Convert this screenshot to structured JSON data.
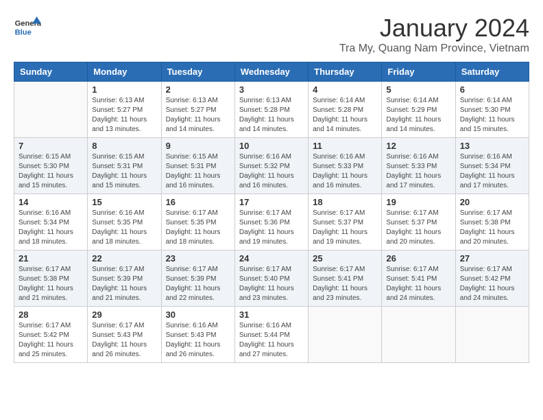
{
  "header": {
    "logo_general": "General",
    "logo_blue": "Blue",
    "month_title": "January 2024",
    "location": "Tra My, Quang Nam Province, Vietnam"
  },
  "calendar": {
    "headers": [
      "Sunday",
      "Monday",
      "Tuesday",
      "Wednesday",
      "Thursday",
      "Friday",
      "Saturday"
    ],
    "weeks": [
      [
        {
          "day": "",
          "info": ""
        },
        {
          "day": "1",
          "info": "Sunrise: 6:13 AM\nSunset: 5:27 PM\nDaylight: 11 hours\nand 13 minutes."
        },
        {
          "day": "2",
          "info": "Sunrise: 6:13 AM\nSunset: 5:27 PM\nDaylight: 11 hours\nand 14 minutes."
        },
        {
          "day": "3",
          "info": "Sunrise: 6:13 AM\nSunset: 5:28 PM\nDaylight: 11 hours\nand 14 minutes."
        },
        {
          "day": "4",
          "info": "Sunrise: 6:14 AM\nSunset: 5:28 PM\nDaylight: 11 hours\nand 14 minutes."
        },
        {
          "day": "5",
          "info": "Sunrise: 6:14 AM\nSunset: 5:29 PM\nDaylight: 11 hours\nand 14 minutes."
        },
        {
          "day": "6",
          "info": "Sunrise: 6:14 AM\nSunset: 5:30 PM\nDaylight: 11 hours\nand 15 minutes."
        }
      ],
      [
        {
          "day": "7",
          "info": "Sunrise: 6:15 AM\nSunset: 5:30 PM\nDaylight: 11 hours\nand 15 minutes."
        },
        {
          "day": "8",
          "info": "Sunrise: 6:15 AM\nSunset: 5:31 PM\nDaylight: 11 hours\nand 15 minutes."
        },
        {
          "day": "9",
          "info": "Sunrise: 6:15 AM\nSunset: 5:31 PM\nDaylight: 11 hours\nand 16 minutes."
        },
        {
          "day": "10",
          "info": "Sunrise: 6:16 AM\nSunset: 5:32 PM\nDaylight: 11 hours\nand 16 minutes."
        },
        {
          "day": "11",
          "info": "Sunrise: 6:16 AM\nSunset: 5:33 PM\nDaylight: 11 hours\nand 16 minutes."
        },
        {
          "day": "12",
          "info": "Sunrise: 6:16 AM\nSunset: 5:33 PM\nDaylight: 11 hours\nand 17 minutes."
        },
        {
          "day": "13",
          "info": "Sunrise: 6:16 AM\nSunset: 5:34 PM\nDaylight: 11 hours\nand 17 minutes."
        }
      ],
      [
        {
          "day": "14",
          "info": "Sunrise: 6:16 AM\nSunset: 5:34 PM\nDaylight: 11 hours\nand 18 minutes."
        },
        {
          "day": "15",
          "info": "Sunrise: 6:16 AM\nSunset: 5:35 PM\nDaylight: 11 hours\nand 18 minutes."
        },
        {
          "day": "16",
          "info": "Sunrise: 6:17 AM\nSunset: 5:35 PM\nDaylight: 11 hours\nand 18 minutes."
        },
        {
          "day": "17",
          "info": "Sunrise: 6:17 AM\nSunset: 5:36 PM\nDaylight: 11 hours\nand 19 minutes."
        },
        {
          "day": "18",
          "info": "Sunrise: 6:17 AM\nSunset: 5:37 PM\nDaylight: 11 hours\nand 19 minutes."
        },
        {
          "day": "19",
          "info": "Sunrise: 6:17 AM\nSunset: 5:37 PM\nDaylight: 11 hours\nand 20 minutes."
        },
        {
          "day": "20",
          "info": "Sunrise: 6:17 AM\nSunset: 5:38 PM\nDaylight: 11 hours\nand 20 minutes."
        }
      ],
      [
        {
          "day": "21",
          "info": "Sunrise: 6:17 AM\nSunset: 5:38 PM\nDaylight: 11 hours\nand 21 minutes."
        },
        {
          "day": "22",
          "info": "Sunrise: 6:17 AM\nSunset: 5:39 PM\nDaylight: 11 hours\nand 21 minutes."
        },
        {
          "day": "23",
          "info": "Sunrise: 6:17 AM\nSunset: 5:39 PM\nDaylight: 11 hours\nand 22 minutes."
        },
        {
          "day": "24",
          "info": "Sunrise: 6:17 AM\nSunset: 5:40 PM\nDaylight: 11 hours\nand 23 minutes."
        },
        {
          "day": "25",
          "info": "Sunrise: 6:17 AM\nSunset: 5:41 PM\nDaylight: 11 hours\nand 23 minutes."
        },
        {
          "day": "26",
          "info": "Sunrise: 6:17 AM\nSunset: 5:41 PM\nDaylight: 11 hours\nand 24 minutes."
        },
        {
          "day": "27",
          "info": "Sunrise: 6:17 AM\nSunset: 5:42 PM\nDaylight: 11 hours\nand 24 minutes."
        }
      ],
      [
        {
          "day": "28",
          "info": "Sunrise: 6:17 AM\nSunset: 5:42 PM\nDaylight: 11 hours\nand 25 minutes."
        },
        {
          "day": "29",
          "info": "Sunrise: 6:17 AM\nSunset: 5:43 PM\nDaylight: 11 hours\nand 26 minutes."
        },
        {
          "day": "30",
          "info": "Sunrise: 6:16 AM\nSunset: 5:43 PM\nDaylight: 11 hours\nand 26 minutes."
        },
        {
          "day": "31",
          "info": "Sunrise: 6:16 AM\nSunset: 5:44 PM\nDaylight: 11 hours\nand 27 minutes."
        },
        {
          "day": "",
          "info": ""
        },
        {
          "day": "",
          "info": ""
        },
        {
          "day": "",
          "info": ""
        }
      ]
    ]
  }
}
